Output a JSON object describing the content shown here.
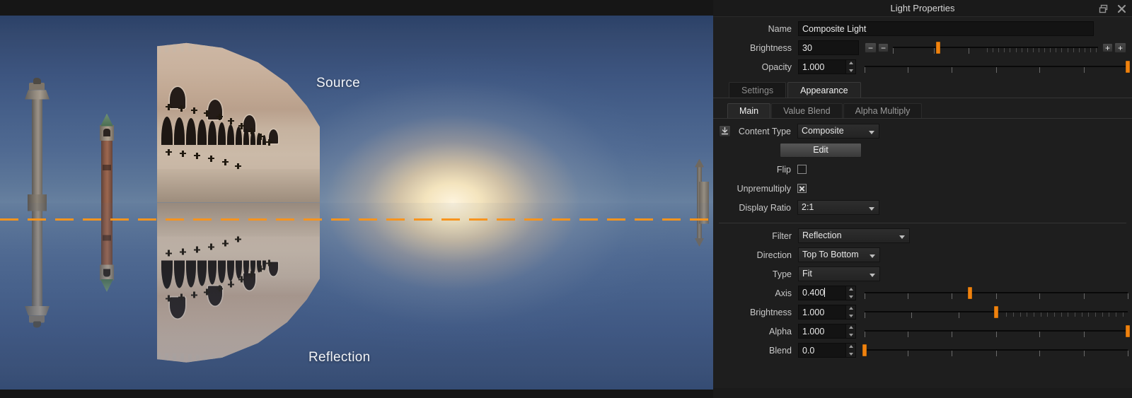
{
  "viewport": {
    "label_source": "Source",
    "label_reflection": "Reflection",
    "horizon_color": "#f7941e",
    "description": "Equirectangular HDRI panorama of Venice (Doge's Palace, Campanile, St Mark's column) with a mirrored reflection below an orange dashed horizon axis line"
  },
  "panel": {
    "title": "Light Properties",
    "buttons": {
      "undock": "undock-icon",
      "close": "close-icon"
    },
    "name": {
      "label": "Name",
      "value": "Composite Light"
    },
    "brightness_top": {
      "label": "Brightness",
      "value": "30",
      "minus_big": "−",
      "minus_small": "−",
      "plus_small": "+",
      "plus_big": "+",
      "handle_pct": 22
    },
    "opacity": {
      "label": "Opacity",
      "value": "1.000",
      "handle_pct": 100
    },
    "tabs": [
      {
        "label": "Settings",
        "active": false
      },
      {
        "label": "Appearance",
        "active": true
      }
    ],
    "subtabs": [
      {
        "label": "Main",
        "active": true
      },
      {
        "label": "Value Blend",
        "active": false
      },
      {
        "label": "Alpha Multiply",
        "active": false
      }
    ],
    "content_type": {
      "label": "Content Type",
      "value": "Composite",
      "icon": "import-arrow-icon"
    },
    "edit_button": {
      "label": "Edit"
    },
    "flip": {
      "label": "Flip",
      "checked": false
    },
    "unpremultiply": {
      "label": "Unpremultiply",
      "state": "mixed"
    },
    "display_ratio": {
      "label": "Display Ratio",
      "value": "2:1"
    },
    "filter": {
      "label": "Filter",
      "value": "Reflection"
    },
    "direction": {
      "label": "Direction",
      "value": "Top To Bottom"
    },
    "type": {
      "label": "Type",
      "value": "Fit"
    },
    "axis": {
      "label": "Axis",
      "value": "0.400",
      "handle_pct": 40,
      "focused": true
    },
    "brightness_bottom": {
      "label": "Brightness",
      "value": "1.000",
      "handle_pct": 50
    },
    "alpha": {
      "label": "Alpha",
      "value": "1.000",
      "handle_pct": 100
    },
    "blend": {
      "label": "Blend",
      "value": "0.0",
      "handle_pct": 0
    }
  }
}
